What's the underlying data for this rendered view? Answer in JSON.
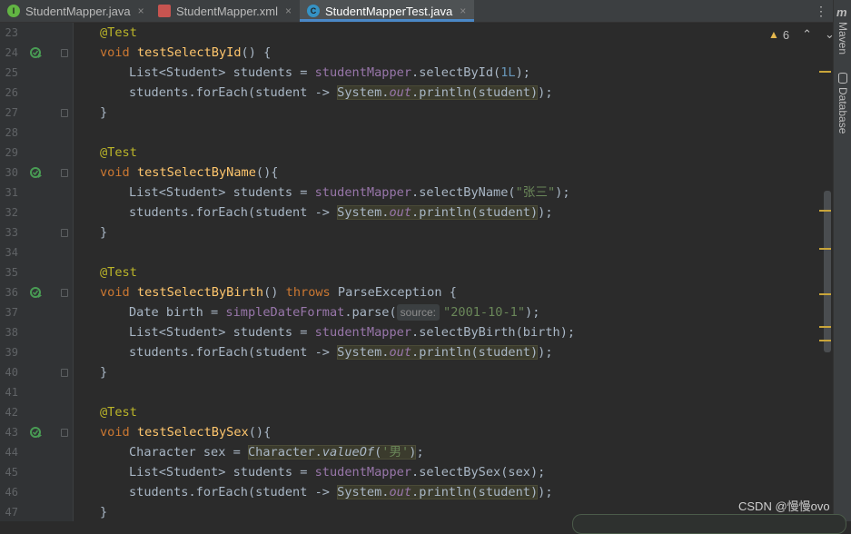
{
  "tabs": [
    {
      "label": "StudentMapper.java",
      "icon": "interface-icon",
      "letter": "I"
    },
    {
      "label": "StudentMapper.xml",
      "icon": "xml-icon",
      "letter": "<>"
    },
    {
      "label": "StudentMapperTest.java",
      "icon": "class-icon",
      "letter": "C"
    }
  ],
  "tab_more": "⋮",
  "close_glyph": "×",
  "inspection": {
    "count": "6"
  },
  "right_panel": {
    "maven": "Maven",
    "database": "Database",
    "maven_icon": "m"
  },
  "watermark": "CSDN @慢慢ovo",
  "line_numbers": [
    "23",
    "24",
    "25",
    "26",
    "27",
    "28",
    "29",
    "30",
    "31",
    "32",
    "33",
    "34",
    "35",
    "36",
    "37",
    "38",
    "39",
    "40",
    "41",
    "42",
    "43",
    "44",
    "45",
    "46",
    "47"
  ],
  "code": {
    "test": "@Test",
    "void": "void",
    "m1": "testSelectById",
    "m1_tail": "() {",
    "list_decl": "List<Student> students = ",
    "mapper": "studentMapper",
    "sel_id": ".selectById(",
    "arg_1l": "1L",
    "close_semi": ");",
    "foreach_head": "students.forEach(student -> ",
    "sysout_sys": "System.",
    "sysout_out": "out",
    "sysout_tail": ".println(student)",
    "close_paren_semi": ");",
    "brace_close": "}",
    "m2": "testSelectByName",
    "m2_tail": "(){",
    "sel_name": ".selectByName(",
    "arg_name": "\"张三\"",
    "m3": "testSelectByBirth",
    "m3_mid": "() ",
    "throws": "throws",
    "m3_tail": " ParseException {",
    "date_decl": "Date birth = ",
    "sdf": "simpleDateFormat",
    "parse": ".parse(",
    "hint_source": "source:",
    "arg_date": "\"2001-10-1\"",
    "sel_birth": ".selectByBirth(birth);",
    "m4": "testSelectBySex",
    "m4_tail": "(){",
    "char_decl": "Character sex = ",
    "char_cls": "Character.",
    "value_of": "valueOf",
    "paren_open": "(",
    "arg_sex": "'男'",
    "paren_close": ")",
    "semi": ";",
    "sel_sex": ".selectBySex(sex);"
  }
}
